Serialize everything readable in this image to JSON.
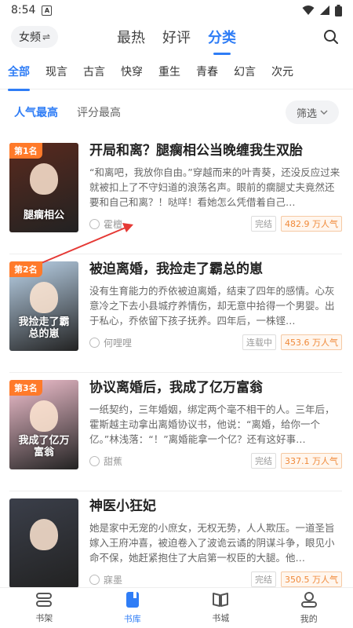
{
  "status_bar": {
    "time": "8:54",
    "badge": "A"
  },
  "top_nav": {
    "gender_label": "女频",
    "gender_switch_glyph": "⇌",
    "tabs": [
      {
        "label": "最热",
        "active": false
      },
      {
        "label": "好评",
        "active": false
      },
      {
        "label": "分类",
        "active": true
      }
    ],
    "search_icon": "search-icon"
  },
  "categories": [
    {
      "label": "全部",
      "active": true
    },
    {
      "label": "现言",
      "active": false
    },
    {
      "label": "古言",
      "active": false
    },
    {
      "label": "快穿",
      "active": false
    },
    {
      "label": "重生",
      "active": false
    },
    {
      "label": "青春",
      "active": false
    },
    {
      "label": "幻言",
      "active": false
    },
    {
      "label": "次元",
      "active": false
    }
  ],
  "sort": {
    "options": [
      {
        "label": "人气最高",
        "active": true
      },
      {
        "label": "评分最高",
        "active": false
      }
    ],
    "filter_label": "筛选"
  },
  "books": [
    {
      "rank": "第1名",
      "title": "开局和离？腿瘸相公当晚缠我生双胎",
      "desc": "“和离吧，我放你自由。”穿越而来的叶青葵，还没反应过来就被扣上了不守妇道的浪荡名声。眼前的瘸腿丈夫竟然还要和自己和离？！哒咩！看她怎么凭借着自己…",
      "author": "霍檀",
      "status": "完结",
      "popularity": "482.9 万人气",
      "cover_text": "腿瘸相公",
      "cover_color": "#5a2a1e"
    },
    {
      "rank": "第2名",
      "title": "被迫离婚，我捡走了霸总的崽",
      "desc": "没有生育能力的乔依被迫离婚，结束了四年的感情。心灰意冷之下去小县城疗养情伤，却无意中拾得一个男婴。出于私心，乔依留下孩子抚养。四年后，一株铿…",
      "author": "何哩哩",
      "status": "连载中",
      "popularity": "453.6 万人气",
      "cover_text": "我捡走了霸总的崽",
      "cover_color": "#bcd4ea"
    },
    {
      "rank": "第3名",
      "title": "协议离婚后，我成了亿万富翁",
      "desc": "一纸契约，三年婚姻，绑定两个毫不相干的人。三年后，霍斯越主动拿出离婚协议书，他说：“离婚，给你一个亿。”林浅落：“！”离婚能拿一个亿？还有这好事…",
      "author": "甜蕉",
      "status": "完结",
      "popularity": "337.1 万人气",
      "cover_text": "我成了亿万富翁",
      "cover_color": "#f3c2d0"
    },
    {
      "rank": "",
      "title": "神医小狂妃",
      "desc": "她是家中无宠的小庶女，无权无势，人人欺压。一道圣旨嫁入王府冲喜，被迫卷入了波诡云谲的阴谋斗争，眼见小命不保，她赶紧抱住了大启第一权臣的大腿。他…",
      "author": "寐墨",
      "status": "完结",
      "popularity": "350.5 万人气",
      "cover_text": "",
      "cover_color": "#3b3f4a"
    }
  ],
  "bottom_nav": [
    {
      "label": "书架",
      "icon": "bookshelf-icon",
      "active": false
    },
    {
      "label": "书库",
      "icon": "library-icon",
      "active": true
    },
    {
      "label": "书城",
      "icon": "bookstore-icon",
      "active": false
    },
    {
      "label": "我的",
      "icon": "profile-icon",
      "active": false
    }
  ],
  "colors": {
    "accent": "#2f7df6",
    "rank_badge": "#ff7a2a",
    "annotation_arrow": "#e53935"
  }
}
